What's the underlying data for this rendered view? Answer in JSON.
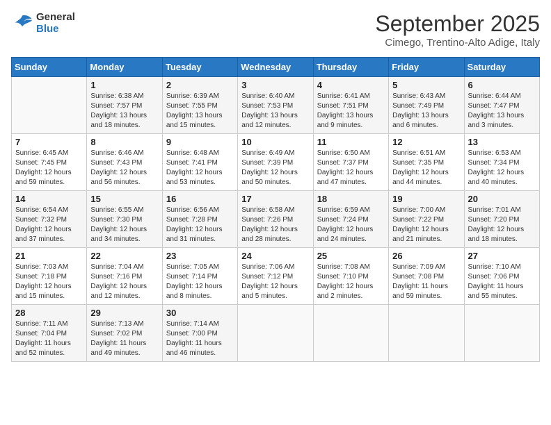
{
  "header": {
    "logo_line1": "General",
    "logo_line2": "Blue",
    "month": "September 2025",
    "location": "Cimego, Trentino-Alto Adige, Italy"
  },
  "days_of_week": [
    "Sunday",
    "Monday",
    "Tuesday",
    "Wednesday",
    "Thursday",
    "Friday",
    "Saturday"
  ],
  "weeks": [
    [
      {
        "day": "",
        "info": ""
      },
      {
        "day": "1",
        "info": "Sunrise: 6:38 AM\nSunset: 7:57 PM\nDaylight: 13 hours\nand 18 minutes."
      },
      {
        "day": "2",
        "info": "Sunrise: 6:39 AM\nSunset: 7:55 PM\nDaylight: 13 hours\nand 15 minutes."
      },
      {
        "day": "3",
        "info": "Sunrise: 6:40 AM\nSunset: 7:53 PM\nDaylight: 13 hours\nand 12 minutes."
      },
      {
        "day": "4",
        "info": "Sunrise: 6:41 AM\nSunset: 7:51 PM\nDaylight: 13 hours\nand 9 minutes."
      },
      {
        "day": "5",
        "info": "Sunrise: 6:43 AM\nSunset: 7:49 PM\nDaylight: 13 hours\nand 6 minutes."
      },
      {
        "day": "6",
        "info": "Sunrise: 6:44 AM\nSunset: 7:47 PM\nDaylight: 13 hours\nand 3 minutes."
      }
    ],
    [
      {
        "day": "7",
        "info": "Sunrise: 6:45 AM\nSunset: 7:45 PM\nDaylight: 12 hours\nand 59 minutes."
      },
      {
        "day": "8",
        "info": "Sunrise: 6:46 AM\nSunset: 7:43 PM\nDaylight: 12 hours\nand 56 minutes."
      },
      {
        "day": "9",
        "info": "Sunrise: 6:48 AM\nSunset: 7:41 PM\nDaylight: 12 hours\nand 53 minutes."
      },
      {
        "day": "10",
        "info": "Sunrise: 6:49 AM\nSunset: 7:39 PM\nDaylight: 12 hours\nand 50 minutes."
      },
      {
        "day": "11",
        "info": "Sunrise: 6:50 AM\nSunset: 7:37 PM\nDaylight: 12 hours\nand 47 minutes."
      },
      {
        "day": "12",
        "info": "Sunrise: 6:51 AM\nSunset: 7:35 PM\nDaylight: 12 hours\nand 44 minutes."
      },
      {
        "day": "13",
        "info": "Sunrise: 6:53 AM\nSunset: 7:34 PM\nDaylight: 12 hours\nand 40 minutes."
      }
    ],
    [
      {
        "day": "14",
        "info": "Sunrise: 6:54 AM\nSunset: 7:32 PM\nDaylight: 12 hours\nand 37 minutes."
      },
      {
        "day": "15",
        "info": "Sunrise: 6:55 AM\nSunset: 7:30 PM\nDaylight: 12 hours\nand 34 minutes."
      },
      {
        "day": "16",
        "info": "Sunrise: 6:56 AM\nSunset: 7:28 PM\nDaylight: 12 hours\nand 31 minutes."
      },
      {
        "day": "17",
        "info": "Sunrise: 6:58 AM\nSunset: 7:26 PM\nDaylight: 12 hours\nand 28 minutes."
      },
      {
        "day": "18",
        "info": "Sunrise: 6:59 AM\nSunset: 7:24 PM\nDaylight: 12 hours\nand 24 minutes."
      },
      {
        "day": "19",
        "info": "Sunrise: 7:00 AM\nSunset: 7:22 PM\nDaylight: 12 hours\nand 21 minutes."
      },
      {
        "day": "20",
        "info": "Sunrise: 7:01 AM\nSunset: 7:20 PM\nDaylight: 12 hours\nand 18 minutes."
      }
    ],
    [
      {
        "day": "21",
        "info": "Sunrise: 7:03 AM\nSunset: 7:18 PM\nDaylight: 12 hours\nand 15 minutes."
      },
      {
        "day": "22",
        "info": "Sunrise: 7:04 AM\nSunset: 7:16 PM\nDaylight: 12 hours\nand 12 minutes."
      },
      {
        "day": "23",
        "info": "Sunrise: 7:05 AM\nSunset: 7:14 PM\nDaylight: 12 hours\nand 8 minutes."
      },
      {
        "day": "24",
        "info": "Sunrise: 7:06 AM\nSunset: 7:12 PM\nDaylight: 12 hours\nand 5 minutes."
      },
      {
        "day": "25",
        "info": "Sunrise: 7:08 AM\nSunset: 7:10 PM\nDaylight: 12 hours\nand 2 minutes."
      },
      {
        "day": "26",
        "info": "Sunrise: 7:09 AM\nSunset: 7:08 PM\nDaylight: 11 hours\nand 59 minutes."
      },
      {
        "day": "27",
        "info": "Sunrise: 7:10 AM\nSunset: 7:06 PM\nDaylight: 11 hours\nand 55 minutes."
      }
    ],
    [
      {
        "day": "28",
        "info": "Sunrise: 7:11 AM\nSunset: 7:04 PM\nDaylight: 11 hours\nand 52 minutes."
      },
      {
        "day": "29",
        "info": "Sunrise: 7:13 AM\nSunset: 7:02 PM\nDaylight: 11 hours\nand 49 minutes."
      },
      {
        "day": "30",
        "info": "Sunrise: 7:14 AM\nSunset: 7:00 PM\nDaylight: 11 hours\nand 46 minutes."
      },
      {
        "day": "",
        "info": ""
      },
      {
        "day": "",
        "info": ""
      },
      {
        "day": "",
        "info": ""
      },
      {
        "day": "",
        "info": ""
      }
    ]
  ]
}
